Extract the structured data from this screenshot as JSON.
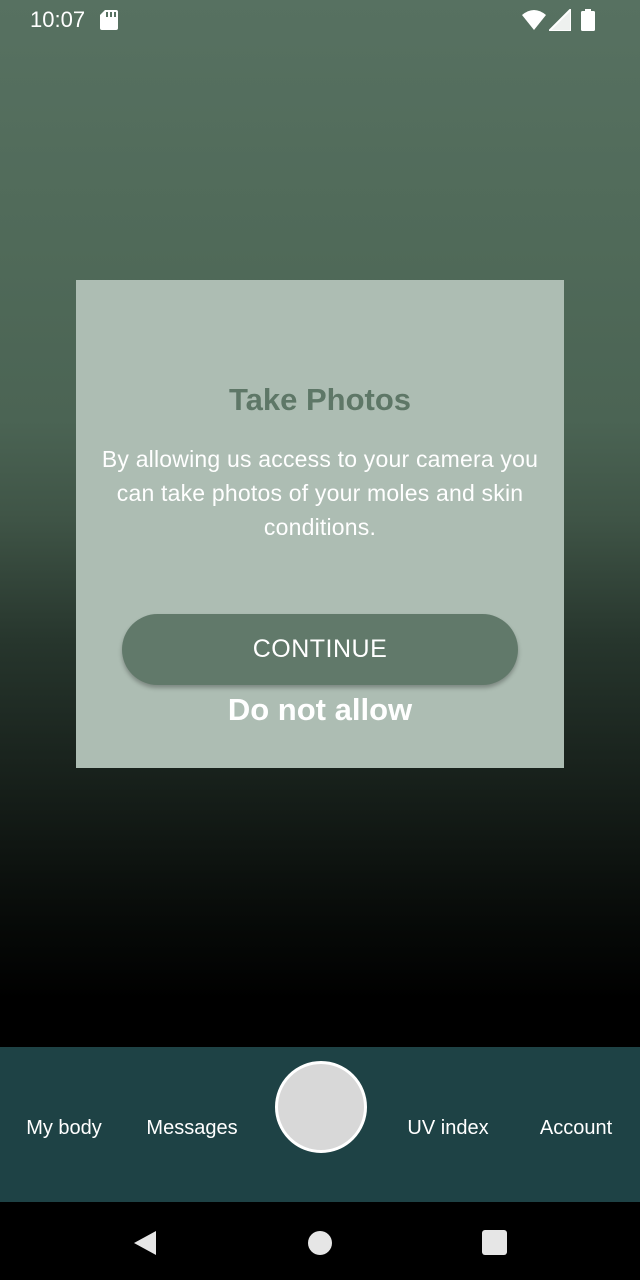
{
  "status_bar": {
    "time": "10:07",
    "icons": [
      "sd-card-icon",
      "wifi-icon",
      "cellular-signal-icon",
      "battery-icon"
    ]
  },
  "dialog": {
    "title": "Take Photos",
    "body": "By allowing us access to your camera you can take photos of your moles and skin conditions.",
    "primary_button": "CONTINUE",
    "secondary_link": "Do not allow"
  },
  "bottom_nav": {
    "items": [
      {
        "label": "My body"
      },
      {
        "label": "Messages"
      },
      {
        "label": "UV index"
      },
      {
        "label": "Account"
      }
    ],
    "center_action": "camera-capture-button"
  },
  "system_nav": {
    "icons": [
      "back-icon",
      "home-icon",
      "recents-icon"
    ]
  },
  "colors": {
    "dialog_background": "#adbdb3",
    "dialog_title": "#5e7767",
    "primary_button": "#61796a",
    "bottom_nav_background": "#1e4245",
    "capture_button": "#d8d8d8"
  }
}
